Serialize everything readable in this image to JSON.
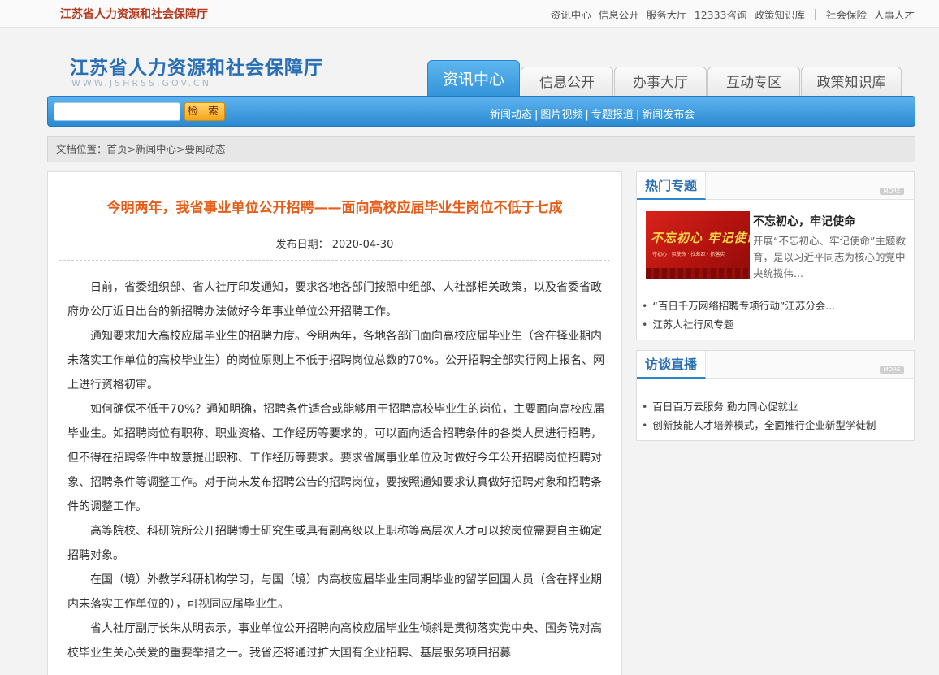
{
  "topbar": {
    "site_name": "江苏省人力资源和社会保障厅",
    "links": [
      "资讯中心",
      "信息公开",
      "服务大厅",
      "12333咨询",
      "政策知识库"
    ],
    "links_right": [
      "社会保险",
      "人事人才"
    ]
  },
  "header": {
    "logo_cn": "江苏省人力资源和社会保障厅",
    "logo_en": "WWW.JSHRSS.GOV.CN"
  },
  "nav": {
    "tabs": [
      {
        "label": "资讯中心",
        "active": true
      },
      {
        "label": "信息公开",
        "active": false
      },
      {
        "label": "办事大厅",
        "active": false
      },
      {
        "label": "互动专区",
        "active": false
      },
      {
        "label": "政策知识库",
        "active": false
      }
    ],
    "search_button": "检 索",
    "subnav": [
      "新闻动态",
      "图片视频",
      "专题报道",
      "新闻发布会"
    ]
  },
  "breadcrumb": "文档位置：首页>新闻中心>要闻动态",
  "article": {
    "title": "今明两年，我省事业单位公开招聘——面向高校应届毕业生岗位不低于七成",
    "date": "发布日期：  2020-04-30",
    "paragraphs": [
      "日前，省委组织部、省人社厅印发通知，要求各地各部门按照中组部、人社部相关政策，以及省委省政府办公厅近日出台的新招聘办法做好今年事业单位公开招聘工作。",
      "通知要求加大高校应届毕业生的招聘力度。今明两年，各地各部门面向高校应届毕业生（含在择业期内未落实工作单位的高校毕业生）的岗位原则上不低于招聘岗位总数的70%。公开招聘全部实行网上报名、网上进行资格初审。",
      "如何确保不低于70%？通知明确，招聘条件适合或能够用于招聘高校毕业生的岗位，主要面向高校应届毕业生。如招聘岗位有职称、职业资格、工作经历等要求的，可以面向适合招聘条件的各类人员进行招聘，但不得在招聘条件中故意提出职称、工作经历等要求。要求省属事业单位及时做好今年公开招聘岗位招聘对象、招聘条件等调整工作。对于尚未发布招聘公告的招聘岗位，要按照通知要求认真做好招聘对象和招聘条件的调整工作。",
      "高等院校、科研院所公开招聘博士研究生或具有副高级以上职称等高层次人才可以按岗位需要自主确定招聘对象。",
      "在国（境）外教学科研机构学习，与国（境）内高校应届毕业生同期毕业的留学回国人员（含在择业期内未落实工作单位的），可视同应届毕业生。",
      "省人社厅副厅长朱从明表示，事业单位公开招聘向高校应届毕业生倾斜是贯彻落实党中央、国务院对高校毕业生关心关爱的重要举措之一。我省还将通过扩大国有企业招聘、基层服务项目招募"
    ]
  },
  "sidebar": {
    "hot": {
      "title": "热门专题",
      "more": "MORE",
      "feature_image_text": "不忘初心 牢记使命",
      "feature_image_sub": "守初心 · 担使命 · 找差距 · 抓落实",
      "feature_title": "不忘初心，牢记使命",
      "feature_desc": "开展“不忘初心、牢记使命”主题教育，是以习近平同志为核心的党中央统揽伟...",
      "items": [
        "“百日千万网络招聘专项行动”江苏分会...",
        "江苏人社行风专题"
      ]
    },
    "interview": {
      "title": "访谈直播",
      "more": "MORE",
      "items": [
        "百日百万云服务 勤力同心促就业",
        "创新技能人才培养模式，全面推行企业新型学徒制"
      ]
    }
  }
}
